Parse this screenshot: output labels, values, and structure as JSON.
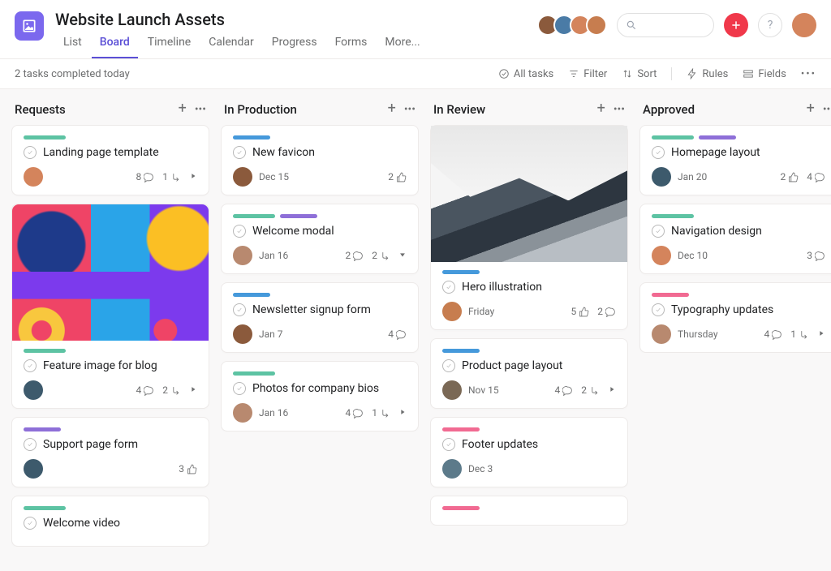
{
  "project": {
    "title": "Website Launch Assets"
  },
  "tabs": {
    "list": "List",
    "board": "Board",
    "timeline": "Timeline",
    "calendar": "Calendar",
    "progress": "Progress",
    "forms": "Forms",
    "more": "More..."
  },
  "toolbar": {
    "status": "2 tasks completed today",
    "all_tasks": "All tasks",
    "filter": "Filter",
    "sort": "Sort",
    "rules": "Rules",
    "fields": "Fields"
  },
  "columns": [
    {
      "title": "Requests",
      "cards": [
        {
          "pills": [
            "teal"
          ],
          "title": "Landing page template",
          "avatar": "av3",
          "date": "",
          "stats": {
            "comments": 8,
            "subtasks": 1
          },
          "caret": true
        },
        {
          "image": "abstract",
          "pills": [
            "teal"
          ],
          "title": "Feature image for blog",
          "avatar": "av5",
          "date": "",
          "stats": {
            "comments": 4,
            "subtasks": 2
          },
          "caret": true
        },
        {
          "pills": [
            "purple"
          ],
          "title": "Support page form",
          "avatar": "av5",
          "date": "",
          "stats": {
            "likes": 3
          }
        },
        {
          "pills": [
            "teal"
          ],
          "title": "Welcome video",
          "avatar": "",
          "date": "",
          "stats": {}
        }
      ]
    },
    {
      "title": "In Production",
      "cards": [
        {
          "pills": [
            "blue"
          ],
          "title": "New favicon",
          "avatar": "av1",
          "date": "Dec 15",
          "stats": {
            "likes": 2
          }
        },
        {
          "pills": [
            "teal",
            "purple"
          ],
          "title": "Welcome modal",
          "avatar": "av6",
          "date": "Jan 16",
          "stats": {
            "comments": 2,
            "subtasks": 2
          },
          "caret": "down"
        },
        {
          "pills": [
            "blue"
          ],
          "title": "Newsletter signup form",
          "avatar": "av1",
          "date": "Jan 7",
          "stats": {
            "comments": 4
          }
        },
        {
          "pills": [
            "teal"
          ],
          "title": "Photos for company bios",
          "avatar": "av6",
          "date": "Jan 16",
          "stats": {
            "comments": 4,
            "subtasks": 1
          },
          "caret": true
        }
      ]
    },
    {
      "title": "In Review",
      "cards": [
        {
          "image": "mountain",
          "pills": [
            "blue"
          ],
          "title": "Hero illustration",
          "avatar": "av4",
          "date": "Friday",
          "stats": {
            "likes": 5,
            "comments": 2
          }
        },
        {
          "pills": [
            "blue"
          ],
          "title": "Product page layout",
          "avatar": "av7",
          "date": "Nov 15",
          "stats": {
            "comments": 4,
            "subtasks": 2
          },
          "caret": true
        },
        {
          "pills": [
            "pink"
          ],
          "title": "Footer updates",
          "avatar": "av8",
          "date": "Dec 3"
        },
        {
          "pills": [
            "pink"
          ],
          "title": "",
          "avatar": "",
          "date": ""
        }
      ]
    },
    {
      "title": "Approved",
      "cards": [
        {
          "pills": [
            "teal",
            "purple"
          ],
          "title": "Homepage layout",
          "avatar": "av5",
          "date": "Jan 20",
          "stats": {
            "likes": 2,
            "comments": 4
          }
        },
        {
          "pills": [
            "teal"
          ],
          "title": "Navigation design",
          "avatar": "av3",
          "date": "Dec 10",
          "stats": {
            "comments": 3
          }
        },
        {
          "pills": [
            "pink"
          ],
          "title": "Typography updates",
          "avatar": "av6",
          "date": "Thursday",
          "stats": {
            "comments": 4,
            "subtasks": 1
          },
          "caret": true
        }
      ]
    }
  ]
}
